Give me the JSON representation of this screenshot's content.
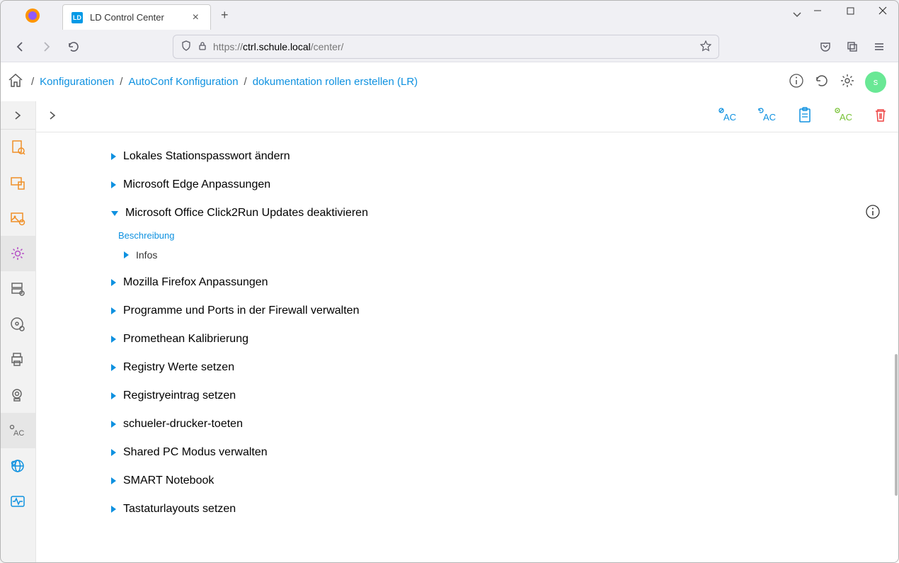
{
  "browser": {
    "tab_title": "LD Control Center",
    "tab_icon_text": "LD",
    "url_prefix": "https://",
    "url_domain": "ctrl.schule.local",
    "url_path": "/center/"
  },
  "breadcrumb": {
    "item1": "Konfigurationen",
    "item2": "AutoConf Konfiguration",
    "item3": "dokumentation rollen erstellen (LR)"
  },
  "avatar_letter": "s",
  "description_label": "Beschreibung",
  "infos_label": "Infos",
  "tree": [
    {
      "label": "Lokales Stationspasswort ändern",
      "expanded": false
    },
    {
      "label": "Microsoft Edge Anpassungen",
      "expanded": false
    },
    {
      "label": "Microsoft Office Click2Run Updates deaktivieren",
      "expanded": true,
      "has_info": true
    },
    {
      "label": "Mozilla Firefox Anpassungen",
      "expanded": false
    },
    {
      "label": "Programme und Ports in der Firewall verwalten",
      "expanded": false
    },
    {
      "label": "Promethean Kalibrierung",
      "expanded": false
    },
    {
      "label": "Registry Werte setzen",
      "expanded": false
    },
    {
      "label": "Registryeintrag setzen",
      "expanded": false
    },
    {
      "label": "schueler-drucker-toeten",
      "expanded": false
    },
    {
      "label": "Shared PC Modus verwalten",
      "expanded": false
    },
    {
      "label": "SMART Notebook",
      "expanded": false
    },
    {
      "label": "Tastaturlayouts setzen",
      "expanded": false
    }
  ],
  "ac_labels": {
    "ac1": "AC",
    "ac2": "AC",
    "ac3": "AC"
  }
}
